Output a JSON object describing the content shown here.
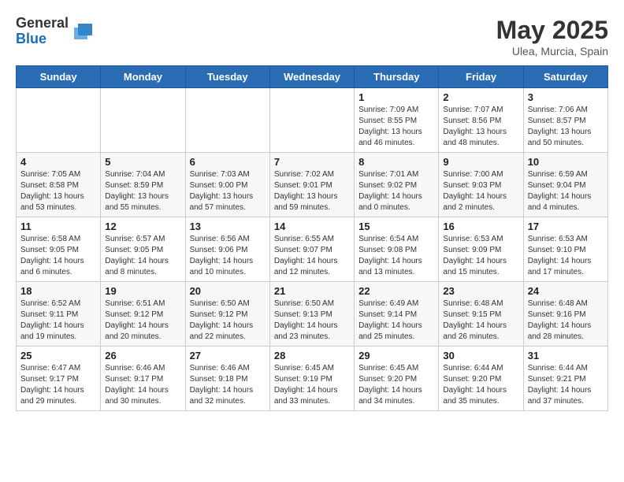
{
  "header": {
    "logo_general": "General",
    "logo_blue": "Blue",
    "month_title": "May 2025",
    "location": "Ulea, Murcia, Spain"
  },
  "weekdays": [
    "Sunday",
    "Monday",
    "Tuesday",
    "Wednesday",
    "Thursday",
    "Friday",
    "Saturday"
  ],
  "rows": [
    [
      {
        "day": "",
        "info": ""
      },
      {
        "day": "",
        "info": ""
      },
      {
        "day": "",
        "info": ""
      },
      {
        "day": "",
        "info": ""
      },
      {
        "day": "1",
        "info": "Sunrise: 7:09 AM\nSunset: 8:55 PM\nDaylight: 13 hours\nand 46 minutes."
      },
      {
        "day": "2",
        "info": "Sunrise: 7:07 AM\nSunset: 8:56 PM\nDaylight: 13 hours\nand 48 minutes."
      },
      {
        "day": "3",
        "info": "Sunrise: 7:06 AM\nSunset: 8:57 PM\nDaylight: 13 hours\nand 50 minutes."
      }
    ],
    [
      {
        "day": "4",
        "info": "Sunrise: 7:05 AM\nSunset: 8:58 PM\nDaylight: 13 hours\nand 53 minutes."
      },
      {
        "day": "5",
        "info": "Sunrise: 7:04 AM\nSunset: 8:59 PM\nDaylight: 13 hours\nand 55 minutes."
      },
      {
        "day": "6",
        "info": "Sunrise: 7:03 AM\nSunset: 9:00 PM\nDaylight: 13 hours\nand 57 minutes."
      },
      {
        "day": "7",
        "info": "Sunrise: 7:02 AM\nSunset: 9:01 PM\nDaylight: 13 hours\nand 59 minutes."
      },
      {
        "day": "8",
        "info": "Sunrise: 7:01 AM\nSunset: 9:02 PM\nDaylight: 14 hours\nand 0 minutes."
      },
      {
        "day": "9",
        "info": "Sunrise: 7:00 AM\nSunset: 9:03 PM\nDaylight: 14 hours\nand 2 minutes."
      },
      {
        "day": "10",
        "info": "Sunrise: 6:59 AM\nSunset: 9:04 PM\nDaylight: 14 hours\nand 4 minutes."
      }
    ],
    [
      {
        "day": "11",
        "info": "Sunrise: 6:58 AM\nSunset: 9:05 PM\nDaylight: 14 hours\nand 6 minutes."
      },
      {
        "day": "12",
        "info": "Sunrise: 6:57 AM\nSunset: 9:05 PM\nDaylight: 14 hours\nand 8 minutes."
      },
      {
        "day": "13",
        "info": "Sunrise: 6:56 AM\nSunset: 9:06 PM\nDaylight: 14 hours\nand 10 minutes."
      },
      {
        "day": "14",
        "info": "Sunrise: 6:55 AM\nSunset: 9:07 PM\nDaylight: 14 hours\nand 12 minutes."
      },
      {
        "day": "15",
        "info": "Sunrise: 6:54 AM\nSunset: 9:08 PM\nDaylight: 14 hours\nand 13 minutes."
      },
      {
        "day": "16",
        "info": "Sunrise: 6:53 AM\nSunset: 9:09 PM\nDaylight: 14 hours\nand 15 minutes."
      },
      {
        "day": "17",
        "info": "Sunrise: 6:53 AM\nSunset: 9:10 PM\nDaylight: 14 hours\nand 17 minutes."
      }
    ],
    [
      {
        "day": "18",
        "info": "Sunrise: 6:52 AM\nSunset: 9:11 PM\nDaylight: 14 hours\nand 19 minutes."
      },
      {
        "day": "19",
        "info": "Sunrise: 6:51 AM\nSunset: 9:12 PM\nDaylight: 14 hours\nand 20 minutes."
      },
      {
        "day": "20",
        "info": "Sunrise: 6:50 AM\nSunset: 9:12 PM\nDaylight: 14 hours\nand 22 minutes."
      },
      {
        "day": "21",
        "info": "Sunrise: 6:50 AM\nSunset: 9:13 PM\nDaylight: 14 hours\nand 23 minutes."
      },
      {
        "day": "22",
        "info": "Sunrise: 6:49 AM\nSunset: 9:14 PM\nDaylight: 14 hours\nand 25 minutes."
      },
      {
        "day": "23",
        "info": "Sunrise: 6:48 AM\nSunset: 9:15 PM\nDaylight: 14 hours\nand 26 minutes."
      },
      {
        "day": "24",
        "info": "Sunrise: 6:48 AM\nSunset: 9:16 PM\nDaylight: 14 hours\nand 28 minutes."
      }
    ],
    [
      {
        "day": "25",
        "info": "Sunrise: 6:47 AM\nSunset: 9:17 PM\nDaylight: 14 hours\nand 29 minutes."
      },
      {
        "day": "26",
        "info": "Sunrise: 6:46 AM\nSunset: 9:17 PM\nDaylight: 14 hours\nand 30 minutes."
      },
      {
        "day": "27",
        "info": "Sunrise: 6:46 AM\nSunset: 9:18 PM\nDaylight: 14 hours\nand 32 minutes."
      },
      {
        "day": "28",
        "info": "Sunrise: 6:45 AM\nSunset: 9:19 PM\nDaylight: 14 hours\nand 33 minutes."
      },
      {
        "day": "29",
        "info": "Sunrise: 6:45 AM\nSunset: 9:20 PM\nDaylight: 14 hours\nand 34 minutes."
      },
      {
        "day": "30",
        "info": "Sunrise: 6:44 AM\nSunset: 9:20 PM\nDaylight: 14 hours\nand 35 minutes."
      },
      {
        "day": "31",
        "info": "Sunrise: 6:44 AM\nSunset: 9:21 PM\nDaylight: 14 hours\nand 37 minutes."
      }
    ]
  ]
}
